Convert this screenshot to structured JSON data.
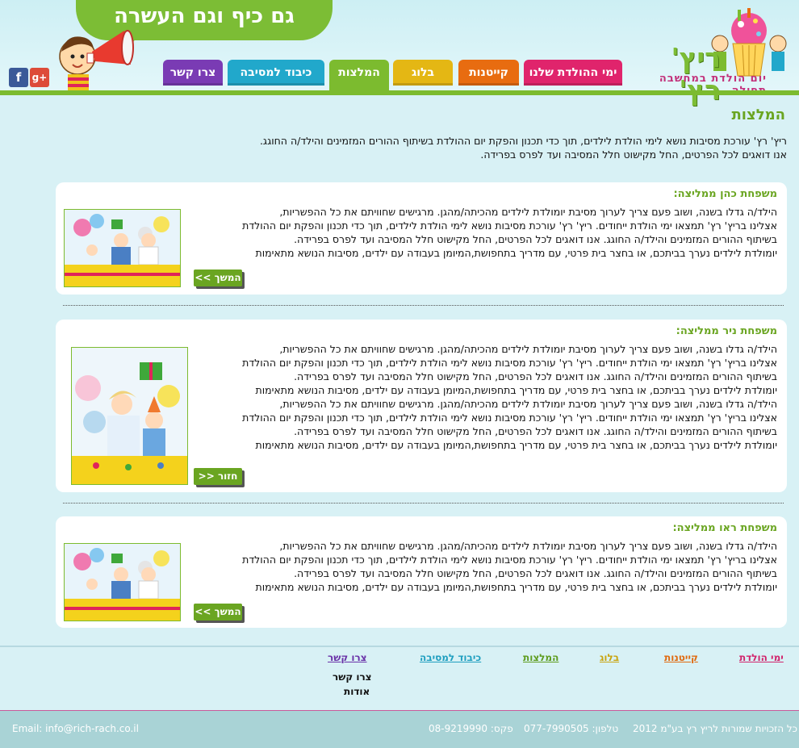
{
  "header": {
    "slogan": "גם כיף וגם העשרה",
    "logo_title": "ריץ' רץ'",
    "logo_subtitle": "יום הולדת במחשבה תחילה",
    "social": {
      "facebook": "f",
      "google_plus": "g+"
    },
    "nav": [
      {
        "label": "ימי ההולדת שלנו",
        "color": "#e0246c"
      },
      {
        "label": "קייטנות",
        "color": "#e86c10"
      },
      {
        "label": "בלוג",
        "color": "#e4b714"
      },
      {
        "label": "המלצות",
        "color": "#7cbb2f",
        "active": true
      },
      {
        "label": "כיבוד למסיבה",
        "color": "#21a8cb"
      },
      {
        "label": "צרו קשר",
        "color": "#7a3bb4"
      }
    ]
  },
  "main": {
    "title": "המלצות",
    "intro_line1": "ריץ' רץ' עורכת מסיבות נושא לימי הולדת לילדים, תוך כדי תכנון והפקת יום ההולדת בשיתוף ההורים המזמינים והילד/ה החוגג.",
    "intro_line2": "אנו דואגים לכל הפרטים, החל מקישוט חלל המסיבה ועד לפרס בפרידה.",
    "cards": [
      {
        "title": "משפחת כהן ממליצה:",
        "lines": [
          "הילד/ה גדלו בשנה, ושוב פעם צריך לערוך מסיבת יומולדת לילדים מהכיתה/מהגן. מרגישים שחוויתם את כל ההפשריות,",
          "אצלינו בריץ' רץ' תמצאו ימי הולדת ייחודים. ריץ' רץ' עורכת מסיבות נושא לימי הולדת לילדים, תוך כדי תכנון והפקת יום ההולדת",
          "בשיתוף ההורים המזמינים והילד/ה החוגג. אנו דואגים לכל הפרטים, החל מקישוט חלל המסיבה ועד לפרס בפרידה.",
          "יומולדת לילדים נערך בביתכם, או בחצר בית פרטי, עם מדריך בתחפושת,המיומן בעבודה עם ילדים, מסיבות הנושא מתאימות"
        ],
        "button": "המשך >>"
      },
      {
        "title": "משפחת ניר ממליצה:",
        "lines": [
          "הילד/ה גדלו בשנה, ושוב פעם צריך לערוך מסיבת יומולדת לילדים מהכיתה/מהגן. מרגישים שחוויתם את כל ההפשריות,",
          "אצלינו בריץ' רץ' תמצאו ימי הולדת ייחודים. ריץ' רץ' עורכת מסיבות נושא לימי הולדת לילדים, תוך כדי תכנון והפקת יום ההולדת",
          "בשיתוף ההורים המזמינים והילד/ה החוגג. אנו דואגים לכל הפרטים, החל מקישוט חלל המסיבה ועד לפרס בפרידה.",
          "יומולדת לילדים נערך בביתכם, או בחצר בית פרטי, עם מדריך בתחפושת,המיומן בעבודה עם ילדים, מסיבות הנושא מתאימות",
          "הילד/ה גדלו בשנה, ושוב פעם צריך לערוך מסיבת יומולדת לילדים מהכיתה/מהגן. מרגישים שחוויתם את כל ההפשריות,",
          "אצלינו בריץ' רץ' תמצאו ימי הולדת ייחודים. ריץ' רץ' עורכת מסיבות נושא לימי הולדת לילדים, תוך כדי תכנון והפקת יום ההולדת",
          "בשיתוף ההורים המזמינים והילד/ה החוגג. אנו דואגים לכל הפרטים, החל מקישוט חלל המסיבה ועד לפרס בפרידה.",
          "יומולדת לילדים נערך בביתכם, או בחצר בית פרטי, עם מדריך בתחפושת,המיומן בעבודה עם ילדים, מסיבות הנושא מתאימות"
        ],
        "button": "חזור <<"
      },
      {
        "title": "משפחת ראו ממליצה:",
        "lines": [
          "הילד/ה גדלו בשנה, ושוב פעם צריך לערוך מסיבת יומולדת לילדים מהכיתה/מהגן. מרגישים שחוויתם את כל ההפשריות,",
          "אצלינו בריץ' רץ' תמצאו ימי הולדת ייחודים. ריץ' רץ' עורכת מסיבות נושא לימי הולדת לילדים, תוך כדי תכנון והפקת יום ההולדת",
          "בשיתוף ההורים המזמינים והילד/ה החוגג. אנו דואגים לכל הפרטים, החל מקישוט חלל המסיבה ועד לפרס בפרידה.",
          "יומולדת לילדים נערך בביתכם, או בחצר בית פרטי, עם מדריך בתחפושת,המיומן בעבודה עם ילדים, מסיבות הנושא מתאימות"
        ],
        "button": "המשך >>"
      }
    ]
  },
  "footer": {
    "links": [
      {
        "label": "ימי הולדת",
        "color": "#d1246c"
      },
      {
        "label": "קייטנות",
        "color": "#e06a10"
      },
      {
        "label": "בלוג",
        "color": "#c9a40f"
      },
      {
        "label": "המלצות",
        "color": "#5e9c1e"
      },
      {
        "label": "כיבוד למסיבה",
        "color": "#1f9fc0"
      },
      {
        "label": "צרו קשר",
        "color": "#6a32a8"
      }
    ],
    "sub_links": [
      "צרו קשר",
      "אודות"
    ],
    "copyright": "כל הזכויות שמורות לריץ רץ בע\"מ 2012",
    "phone": "טלפון: 077-7990505",
    "fax": "פקס: 08-9219990",
    "email": "Email: info@rich-rach.co.il"
  }
}
